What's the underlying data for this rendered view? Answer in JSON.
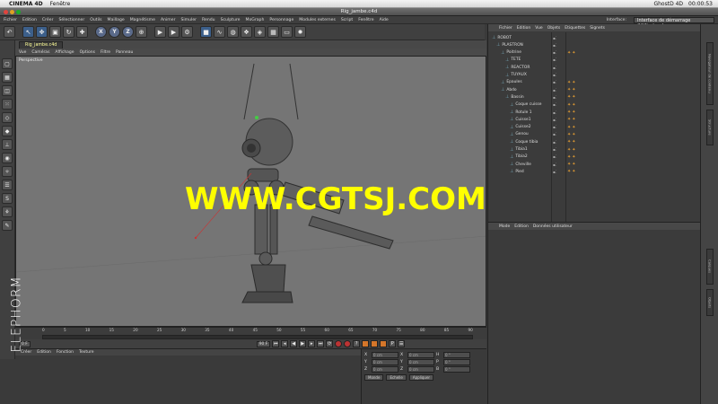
{
  "os_menu": {
    "app_name": "CINEMA 4D",
    "items": [
      "Fenêtre"
    ],
    "status": [
      "GhostD 4D",
      "00:00:53"
    ]
  },
  "window": {
    "title": "Rig_jambe.c4d"
  },
  "main_menu": {
    "items": [
      "Fichier",
      "Edition",
      "Créer",
      "Sélectionner",
      "Outils",
      "Maillage",
      "Magnétisme",
      "Animer",
      "Simuler",
      "Rendu",
      "Sculpture",
      "MoGraph",
      "Personnage",
      "Modules externes",
      "Script",
      "Fenêtre",
      "Aide"
    ],
    "interface_label": "Interface:",
    "interface_value": "Interface de démarrage (Utilisateur)"
  },
  "toolbar": {
    "axis_x": "X",
    "axis_y": "Y",
    "axis_z": "Z"
  },
  "viewport": {
    "tab_label": "Rig_jambe.c4d",
    "menu": [
      "Vue",
      "Caméras",
      "Affichage",
      "Options",
      "Filtre",
      "Panneau"
    ],
    "view_name": "Perspective",
    "watermark": "WWW.CGTSJ.COM"
  },
  "timeline": {
    "ticks": [
      "0",
      "5",
      "10",
      "15",
      "20",
      "25",
      "30",
      "35",
      "40",
      "45",
      "50",
      "55",
      "60",
      "65",
      "70",
      "75",
      "80",
      "85",
      "90"
    ],
    "start_field": "0 F",
    "end_field": "90 F",
    "frame_field": "0 F"
  },
  "material_manager": {
    "menu": [
      "Créer",
      "Edition",
      "Fonction",
      "Texture"
    ]
  },
  "coordinates": {
    "rows": [
      {
        "axis": "X",
        "pos": "0 cm",
        "size": "0 cm",
        "rot_label": "H",
        "rot": "0 °"
      },
      {
        "axis": "Y",
        "pos": "0 cm",
        "size": "0 cm",
        "rot_label": "P",
        "rot": "0 °"
      },
      {
        "axis": "Z",
        "pos": "0 cm",
        "size": "0 cm",
        "rot_label": "B",
        "rot": "0 °"
      }
    ],
    "mode_value": "Monde",
    "scale_value": "Echelle",
    "apply_label": "Appliquer"
  },
  "brand": {
    "name": "ELEPHORM"
  },
  "object_manager": {
    "menu": [
      "Fichier",
      "Edition",
      "Vue",
      "Objets",
      "Etiquettes",
      "Signets"
    ],
    "objects": [
      {
        "name": "ROBOT",
        "indent": 0
      },
      {
        "name": "PLASTRON",
        "indent": 1
      },
      {
        "name": "Poitrine",
        "indent": 2,
        "tags": true
      },
      {
        "name": "TETE",
        "indent": 3
      },
      {
        "name": "REACTOR",
        "indent": 3
      },
      {
        "name": "TUYAUX",
        "indent": 3
      },
      {
        "name": "Epaules",
        "indent": 2,
        "tags": true
      },
      {
        "name": "Abdo",
        "indent": 2,
        "tags": true
      },
      {
        "name": "Bassin",
        "indent": 3,
        "tags": true
      },
      {
        "name": "Coque cuisse",
        "indent": 4,
        "tags": true
      },
      {
        "name": "Rotule 1",
        "indent": 4,
        "tags": true
      },
      {
        "name": "Cuisse1",
        "indent": 4,
        "tags": true
      },
      {
        "name": "Cuisse2",
        "indent": 4,
        "tags": true
      },
      {
        "name": "Genou",
        "indent": 4,
        "tags": true
      },
      {
        "name": "Coque tibia",
        "indent": 4,
        "tags": true
      },
      {
        "name": "Tibia1",
        "indent": 4,
        "tags": true
      },
      {
        "name": "Tibia2",
        "indent": 4,
        "tags": true
      },
      {
        "name": "Cheville",
        "indent": 4,
        "tags": true
      },
      {
        "name": "Pied",
        "indent": 4,
        "tags": true
      }
    ]
  },
  "attribute_manager": {
    "menu": [
      "Mode",
      "Edition",
      "Données utilisateur"
    ]
  },
  "right_tabs": [
    "Navigateur de contenu",
    "Structure",
    "Calques",
    "Objets"
  ],
  "colors": {
    "watermark": "#ffff00",
    "accent": "#d4762a"
  }
}
